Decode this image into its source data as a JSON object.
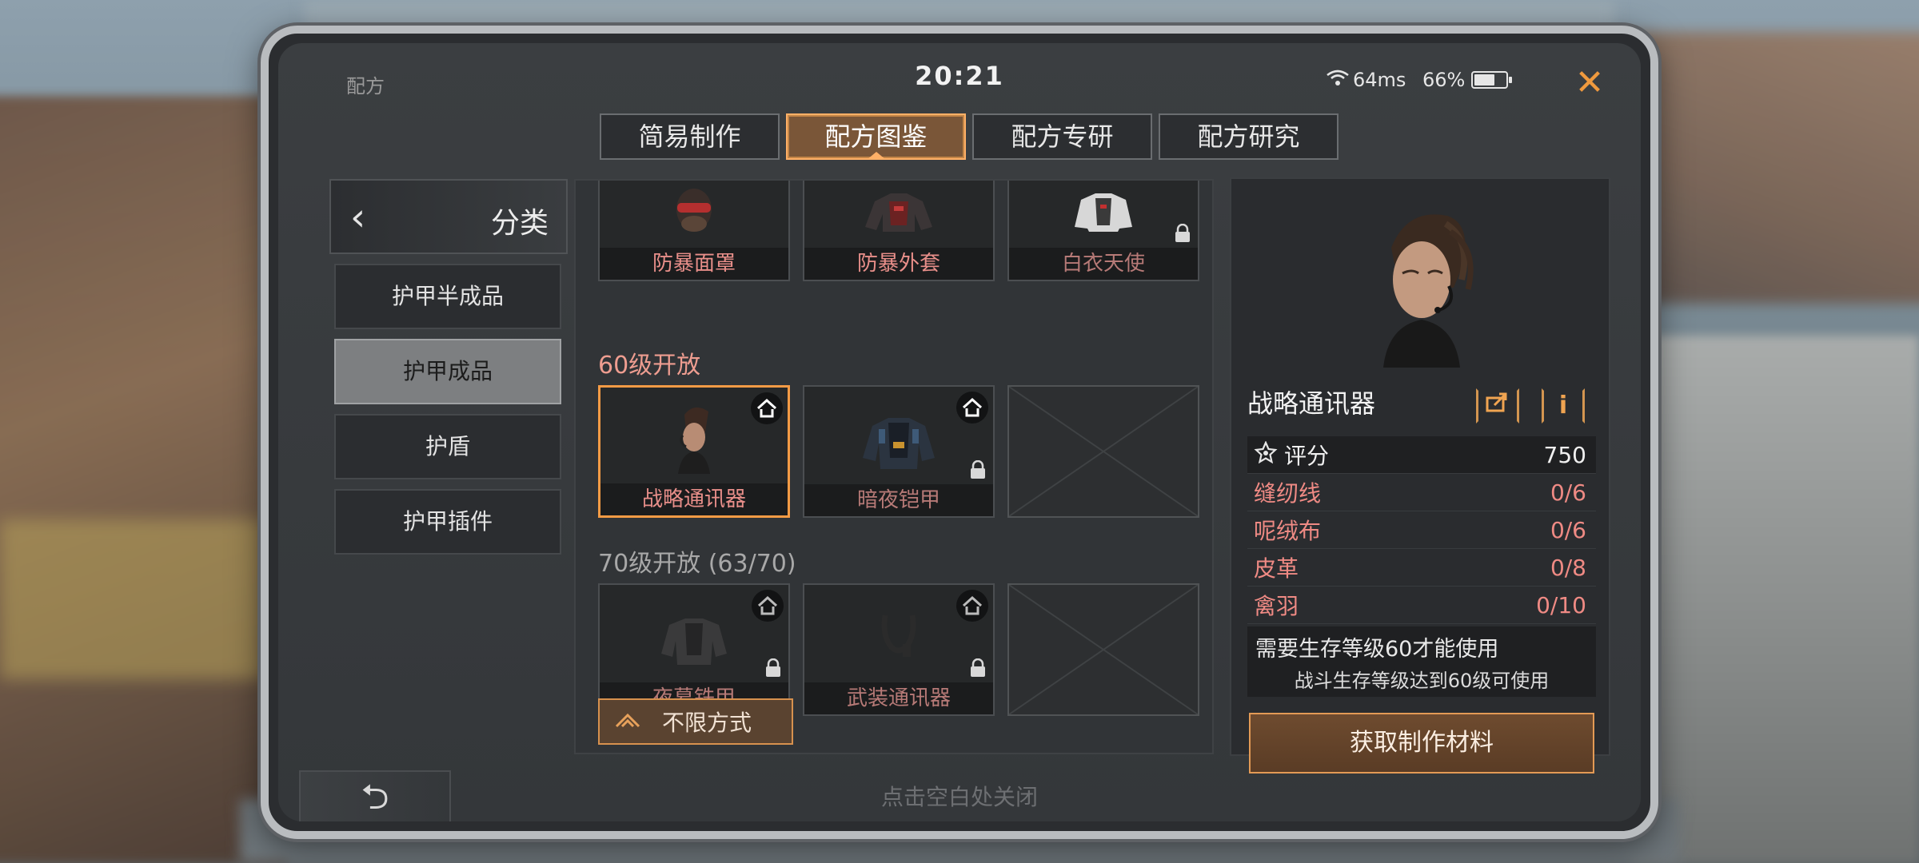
{
  "status": {
    "title": "配方",
    "clock": "20:21",
    "ping": "64ms",
    "battery": "66%",
    "battery_level": 0.66
  },
  "tabs": [
    {
      "label": "简易制作"
    },
    {
      "label": "配方图鉴",
      "active": true
    },
    {
      "label": "配方专研"
    },
    {
      "label": "配方研究"
    }
  ],
  "sidebar": {
    "header": "分类",
    "items": [
      {
        "label": "护甲半成品"
      },
      {
        "label": "护甲成品",
        "active": true
      },
      {
        "label": "护盾"
      },
      {
        "label": "护甲插件"
      }
    ]
  },
  "recipes": {
    "top_row": [
      {
        "name": "防暴面罩",
        "locked": false
      },
      {
        "name": "防暴外套",
        "locked": false
      },
      {
        "name": "白衣天使",
        "locked": true
      }
    ],
    "section60": {
      "label": "60级开放",
      "items": [
        {
          "name": "战略通讯器",
          "locked": false,
          "selected": true
        },
        {
          "name": "暗夜铠甲",
          "locked": true
        }
      ]
    },
    "section70": {
      "label": "70级开放 (63/70)",
      "items": [
        {
          "name": "夜幕铁甲",
          "locked": true
        },
        {
          "name": "武装通讯器",
          "locked": true
        }
      ]
    },
    "mode_button": "不限方式"
  },
  "detail": {
    "name": "战略通讯器",
    "info_icon": "i",
    "score_label": "评分",
    "score_value": "750",
    "materials": [
      {
        "name": "缝纫线",
        "qty": "0/6"
      },
      {
        "name": "呢绒布",
        "qty": "0/6"
      },
      {
        "name": "皮革",
        "qty": "0/8"
      },
      {
        "name": "禽羽",
        "qty": "0/10"
      }
    ],
    "requirement": "需要生存等级60才能使用",
    "requirement_sub": "战斗生存等级达到60级可使用",
    "get_button": "获取制作材料"
  },
  "close_hint": "点击空白处关闭",
  "colors": {
    "accent": "#f59b45",
    "material_red": "#ef8a84"
  }
}
